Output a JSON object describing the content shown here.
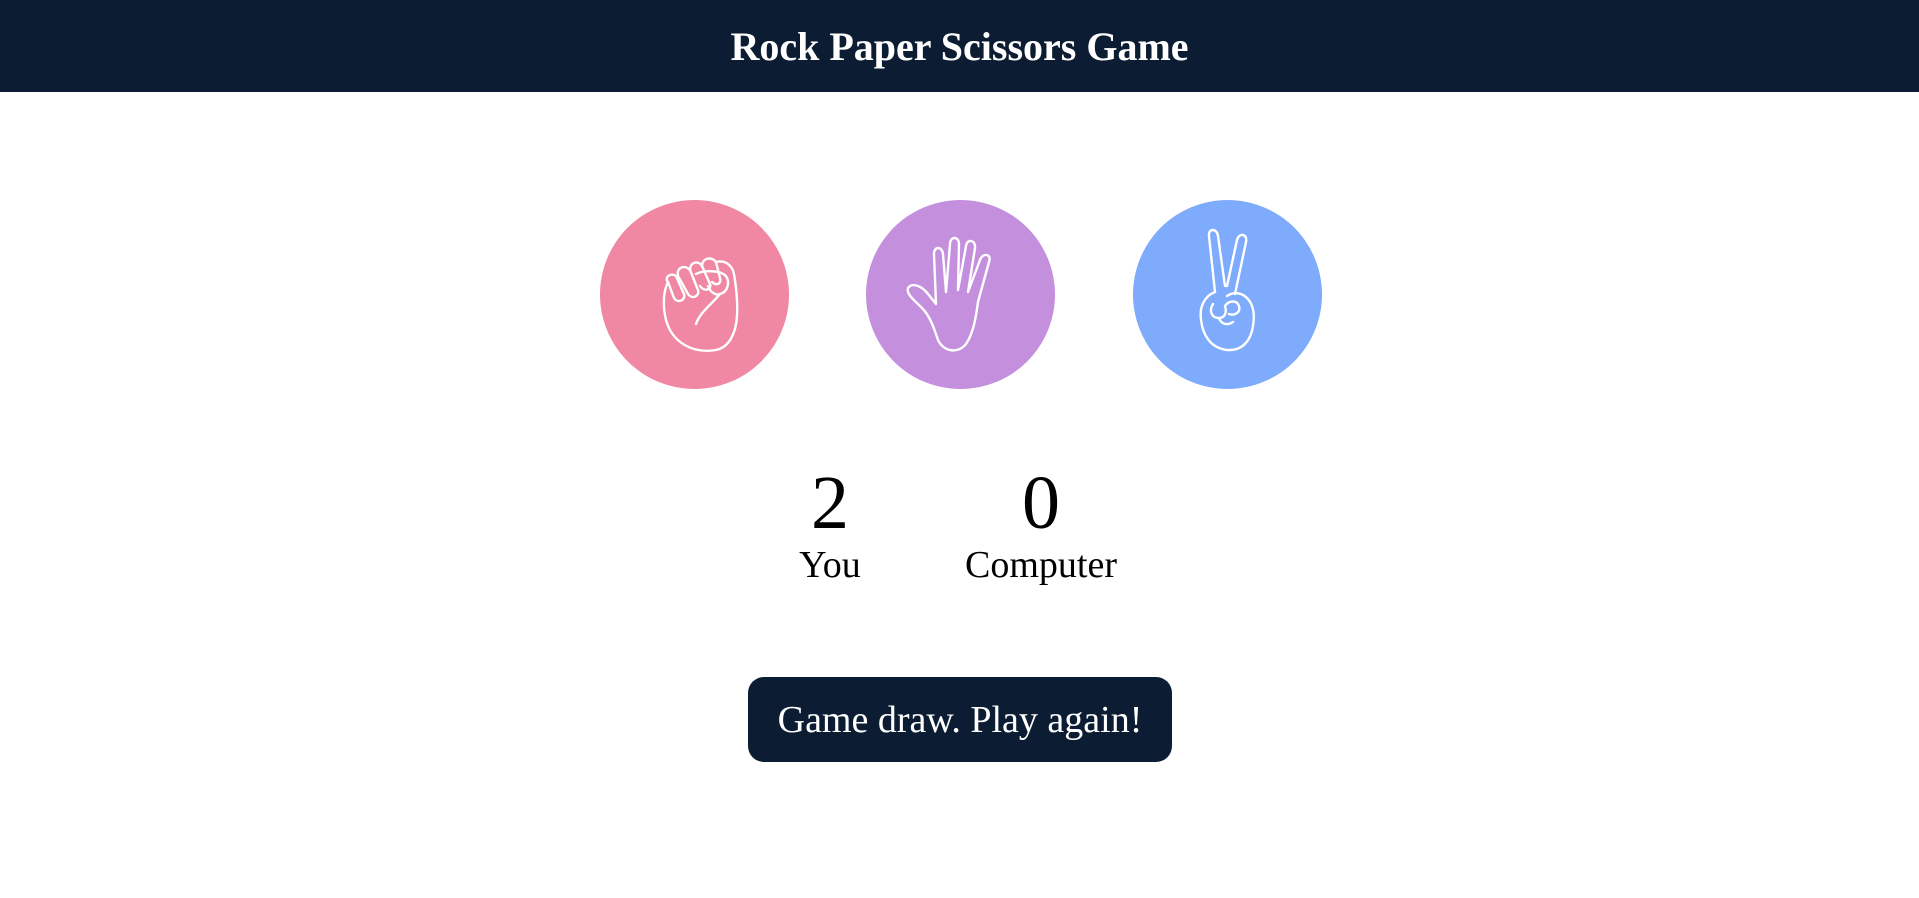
{
  "header": {
    "title": "Rock Paper Scissors Game"
  },
  "choices": [
    {
      "id": "rock",
      "icon": "rock-fist-icon",
      "color": "#f087a3"
    },
    {
      "id": "paper",
      "icon": "paper-hand-icon",
      "color": "#c490de"
    },
    {
      "id": "scissors",
      "icon": "scissors-peace-icon",
      "color": "#7eabfc"
    }
  ],
  "scores": {
    "user": {
      "value": "2",
      "label": "You"
    },
    "computer": {
      "value": "0",
      "label": "Computer"
    }
  },
  "message": {
    "text": "Game draw. Play again!"
  },
  "colors": {
    "header_bg": "#0b1c33",
    "message_bg": "#0b1c33"
  }
}
